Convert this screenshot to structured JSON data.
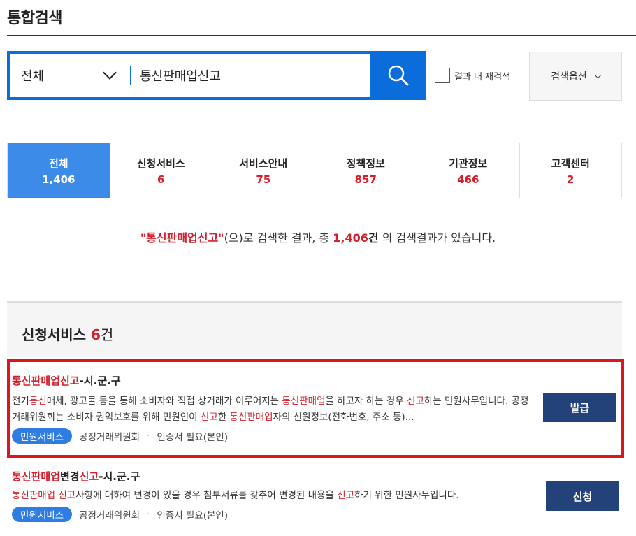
{
  "page": {
    "title": "통합검색"
  },
  "search": {
    "scope_label": "전체",
    "query": "통신판매업신고",
    "refine_label": "결과 내 재검색",
    "options_label": "검색옵션"
  },
  "tabs": [
    {
      "label": "전체",
      "count": "1,406"
    },
    {
      "label": "신청서비스",
      "count": "6"
    },
    {
      "label": "서비스안내",
      "count": "75"
    },
    {
      "label": "정책정보",
      "count": "857"
    },
    {
      "label": "기관정보",
      "count": "466"
    },
    {
      "label": "고객센터",
      "count": "2"
    }
  ],
  "summary": {
    "query_quoted": "\"통신판매업신고\"",
    "part1": "(으)로 검색한 결과, 총 ",
    "total": "1,406",
    "unit": "건",
    "part2": " 의 검색결과가 있습니다."
  },
  "section": {
    "title": "신청서비스",
    "count": "6",
    "unit": "건"
  },
  "results": [
    {
      "title_hl": "통신판매업신고",
      "title_rest": "-시.군.구",
      "desc": [
        {
          "t": "전기",
          "hl": false
        },
        {
          "t": "통신",
          "hl": true
        },
        {
          "t": "매체, 광고물 등을 통해 소비자와 직접 상거래가 이루어지는 ",
          "hl": false
        },
        {
          "t": "통신판매업",
          "hl": true
        },
        {
          "t": "을 하고자 하는 경우 ",
          "hl": false
        },
        {
          "t": "신고",
          "hl": true
        },
        {
          "t": "하는 민원사무입니다. 공정거래위원회는 소비자 권익보호를 위해 민원인이 ",
          "hl": false
        },
        {
          "t": "신고",
          "hl": true
        },
        {
          "t": "한 ",
          "hl": false
        },
        {
          "t": "통신판매업",
          "hl": true
        },
        {
          "t": "자의 신원정보(전화번호, 주소 등)...",
          "hl": false
        }
      ],
      "badge": "민원서비스",
      "agency": "공정거래위원회",
      "requirement": "인증서 필요(본인)",
      "action": "발급"
    },
    {
      "title_hl": "통신판매업",
      "title_mid": "변경",
      "title_hl2": "신고",
      "title_rest": "-시.군.구",
      "desc": [
        {
          "t": "통신판매업 신고",
          "hl": true
        },
        {
          "t": "사항에 대하여 변경이 있을 경우 첨부서류를 갖추어 변경된 내용을 ",
          "hl": false
        },
        {
          "t": "신고",
          "hl": true
        },
        {
          "t": "하기 위한 민원사무입니다.",
          "hl": false
        }
      ],
      "badge": "민원서비스",
      "agency": "공정거래위원회",
      "requirement": "인증서 필요(본인)",
      "action": "신청"
    }
  ],
  "colors": {
    "accent": "#0a6ddb",
    "tab_active": "#3d8be8",
    "highlight": "#d3202c",
    "action": "#24427a",
    "outline": "#e0141e"
  },
  "icons": {
    "search": "search-icon",
    "scope": "chevron-down-icon",
    "options": "chevron-down-icon"
  }
}
